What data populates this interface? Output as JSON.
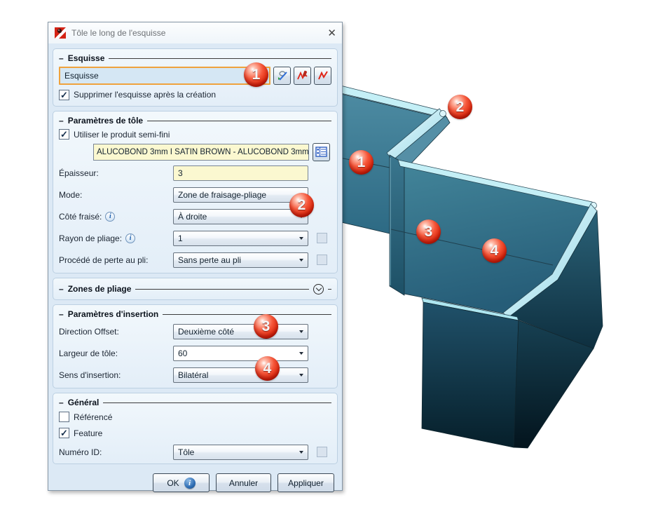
{
  "window": {
    "title": "Tôle le long de l'esquisse",
    "close_icon": "✕"
  },
  "icons": {
    "info": "i"
  },
  "esquisse": {
    "title": "Esquisse",
    "value": "Esquisse",
    "balloon": "1",
    "tool_buttons": [
      "show-sketch",
      "delete-sketch",
      "new-sketch"
    ],
    "delete_label": "Supprimer l'esquisse après la création",
    "delete_checked": "✓"
  },
  "tole": {
    "title": "Paramètres de tôle",
    "semi_label": "Utiliser le produit semi-fini",
    "semi_checked": "✓",
    "product": "ALUCOBOND 3mm I SATIN BROWN - ALUCOBOND 3mm",
    "thickness": {
      "label": "Épaisseur:",
      "value": "3"
    },
    "mode": {
      "label": "Mode:",
      "value": "Zone de fraisage-pliage",
      "balloon": "2"
    },
    "cote": {
      "label": "Côté fraisé:",
      "value": "À droite"
    },
    "rayon": {
      "label": "Rayon de pliage:",
      "value": "1",
      "extra_checked": ""
    },
    "perte": {
      "label": "Procédé de perte au pli:",
      "value": "Sans perte au pli",
      "extra_checked": ""
    }
  },
  "pliage": {
    "title": "Zones de pliage"
  },
  "insertion": {
    "title": "Paramètres d'insertion",
    "offset": {
      "label": "Direction Offset:",
      "value": "Deuxième côté",
      "balloon": "3"
    },
    "largeur": {
      "label": "Largeur de tôle:",
      "value": "60"
    },
    "sens": {
      "label": "Sens d'insertion:",
      "value": "Bilatéral",
      "balloon": "4"
    }
  },
  "general": {
    "title": "Général",
    "ref_label": "Référencé",
    "ref_checked": "",
    "feat_label": "Feature",
    "feat_checked": "✓",
    "id": {
      "label": "Numéro ID:",
      "value": "Tôle",
      "extra_checked": ""
    }
  },
  "footer": {
    "ok": "OK",
    "cancel": "Annuler",
    "apply": "Appliquer"
  },
  "balloons3d": [
    {
      "n": "1"
    },
    {
      "n": "2"
    },
    {
      "n": "3"
    },
    {
      "n": "4"
    }
  ],
  "colors": {
    "accent_orange": "#EFA23D",
    "balloon_red": "#E02C10",
    "field_yellow": "#FBF8D0",
    "dialog_bg": "#DCE9F5",
    "sheet_teal": "#3A7E98",
    "edge_cyan": "#C4EFF6"
  }
}
